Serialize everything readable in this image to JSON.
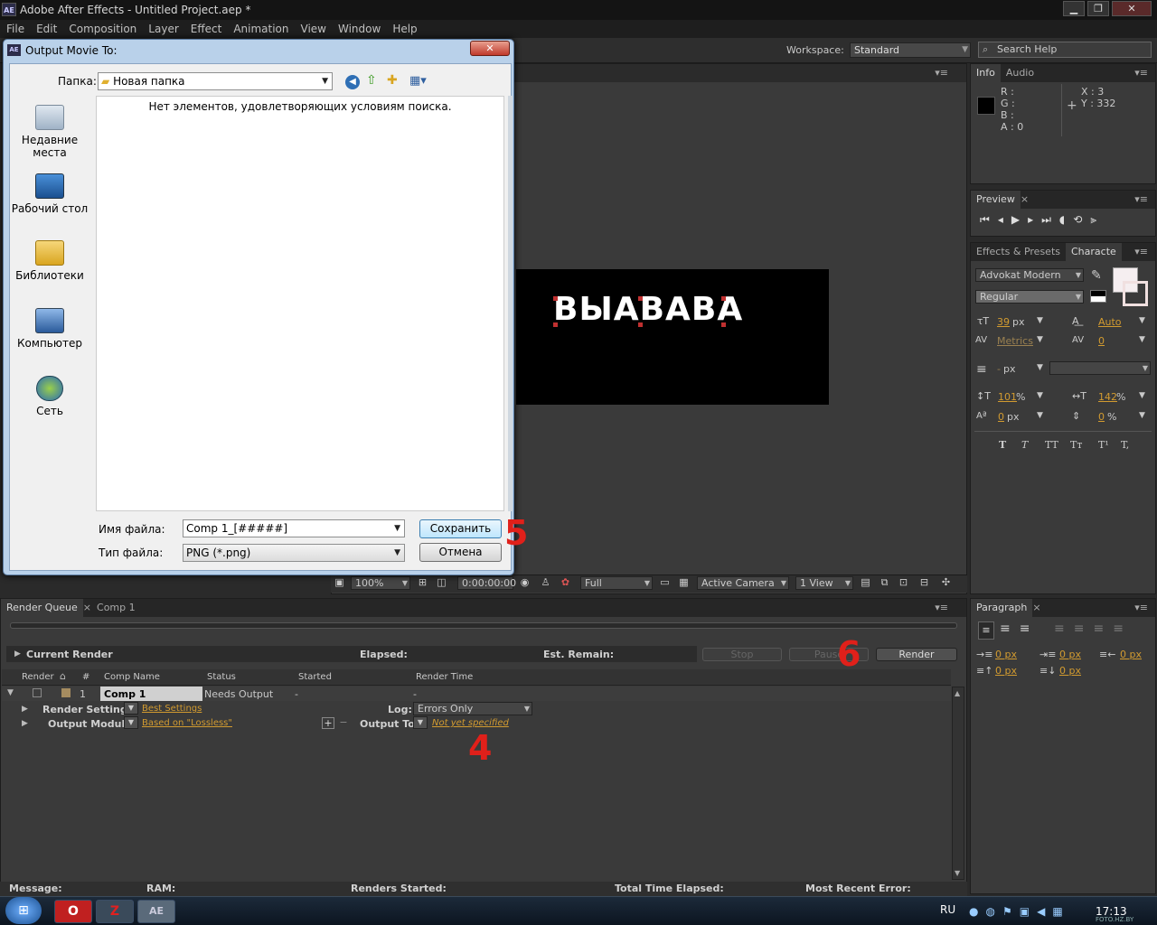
{
  "window": {
    "title": "Adobe After Effects - Untitled Project.aep *",
    "logo": "AE",
    "minimize": "▁",
    "maximize": "❐",
    "close": "✕"
  },
  "menu": [
    "File",
    "Edit",
    "Composition",
    "Layer",
    "Effect",
    "Animation",
    "View",
    "Window",
    "Help"
  ],
  "workspace": {
    "label": "Workspace:",
    "value": "Standard"
  },
  "search": {
    "placeholder": "Search Help"
  },
  "info": {
    "tabs": [
      "Info",
      "Audio"
    ],
    "r": "R :",
    "g": "G :",
    "b": "B :",
    "a": "A : 0",
    "x": "X : 3",
    "y": "Y : 332"
  },
  "preview": {
    "tab": "Preview"
  },
  "character": {
    "tabs": [
      "Effects & Presets",
      "Characte"
    ],
    "font": "Advokat Modern",
    "style": "Regular",
    "size": "39",
    "size_unit": "px",
    "leading": "Auto",
    "kerning": "Metrics",
    "tracking": "0",
    "stroke_unit": "px",
    "vscale": "101",
    "hscale": "142",
    "pct": "%",
    "baseline": "0",
    "baseline_unit": "px",
    "tsume": "0",
    "tsume_unit": "%",
    "styles": [
      "T",
      "T",
      "TT",
      "Tт",
      "T¹",
      "T,"
    ]
  },
  "paragraph": {
    "tab": "Paragraph",
    "indent_left": "0 px",
    "indent_first": "0 px",
    "indent_right": "0 px",
    "space_before": "0 px",
    "space_after": "0 px"
  },
  "comp": {
    "text": "ВЫАВАВА",
    "zoom": "100%",
    "timecode": "0:00:00:00",
    "resolution": "Full",
    "camera": "Active Camera",
    "view": "1 View"
  },
  "render_queue": {
    "tabs": [
      "Render Queue",
      "Comp 1"
    ],
    "current_render": "Current Render",
    "elapsed": "Elapsed:",
    "est_remain": "Est. Remain:",
    "stop": "Stop",
    "pause": "Pause",
    "render": "Render",
    "columns": [
      "Render",
      "#",
      "Comp Name",
      "Status",
      "Started",
      "Render Time"
    ],
    "row": {
      "num": "1",
      "comp": "Comp 1",
      "status": "Needs Output",
      "started": "-",
      "render_time": "-"
    },
    "render_settings_label": "Render Settings:",
    "render_settings_value": "Best Settings",
    "log_label": "Log:",
    "log_value": "Errors Only",
    "output_module_label": "Output Module:",
    "output_module_value": "Based on \"Lossless\"",
    "output_to_label": "Output To:",
    "output_to_value": "Not yet specified"
  },
  "statusbar": {
    "message": "Message:",
    "ram": "RAM:",
    "renders_started": "Renders Started:",
    "total_time": "Total Time Elapsed:",
    "recent_error": "Most Recent Error:"
  },
  "dialog": {
    "title": "Output Movie To:",
    "folder_label": "Папка:",
    "folder_value": "Новая папка",
    "empty_message": "Нет элементов, удовлетворяющих условиям поиска.",
    "places": [
      "Недавние места",
      "Рабочий стол",
      "Библиотеки",
      "Компьютер",
      "Сеть"
    ],
    "filename_label": "Имя файла:",
    "filename_value": "Comp 1_[#####]",
    "filetype_label": "Тип файла:",
    "filetype_value": "PNG (*.png)",
    "save": "Сохранить",
    "cancel": "Отмена",
    "close": "✕"
  },
  "annotations": {
    "step4": "4",
    "step5": "5",
    "step6": "6"
  },
  "taskbar": {
    "lang": "RU",
    "time": "17:13",
    "watermark": "FOTO.HZ.BY"
  }
}
